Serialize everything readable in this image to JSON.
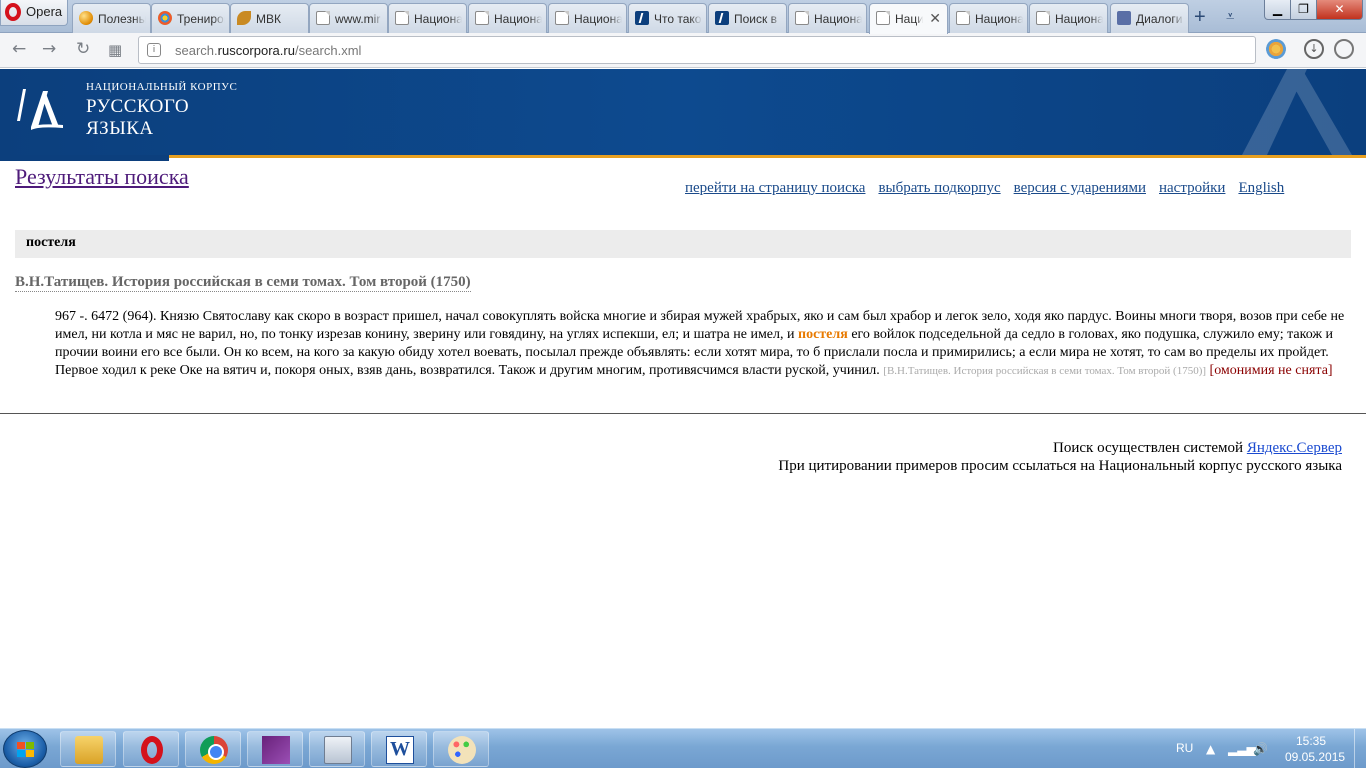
{
  "browser": {
    "menu_label": "Opera",
    "tabs": [
      {
        "title": "Полезные",
        "icon": "ball-icon"
      },
      {
        "title": "Тренировка",
        "icon": "flower-icon"
      },
      {
        "title": "МВК",
        "icon": "leaf-icon"
      },
      {
        "title": "www.mir",
        "icon": "page-icon"
      },
      {
        "title": "Национальный",
        "icon": "page-icon"
      },
      {
        "title": "Национальный",
        "icon": "page-icon"
      },
      {
        "title": "Национальный",
        "icon": "page-icon"
      },
      {
        "title": "Что такое",
        "icon": "nkrja-icon"
      },
      {
        "title": "Поиск в",
        "icon": "nkrja-icon"
      },
      {
        "title": "Национальный",
        "icon": "page-icon"
      },
      {
        "title": "Национальный",
        "icon": "page-icon",
        "active": true
      },
      {
        "title": "Национальный",
        "icon": "page-icon"
      },
      {
        "title": "Национальный",
        "icon": "page-icon"
      },
      {
        "title": "Диалоги",
        "icon": "dialog-icon"
      }
    ],
    "url_prefix": "search.",
    "url_host": "ruscorpora.ru",
    "url_path": "/search.xml",
    "site_icon": "i"
  },
  "site": {
    "header_line1": "НАЦИОНАЛЬНЫЙ КОРПУС",
    "header_line2": "РУССКОГО",
    "header_line3": "ЯЗЫКА",
    "brand_color": "#0c3f7d",
    "accent_color": "#e8a020"
  },
  "page": {
    "title": "Результаты поиска",
    "links": [
      "перейти на страницу поиска",
      "выбрать подкорпус",
      "версия с ударениями",
      "настройки",
      "English"
    ],
    "query": "постеля",
    "doc_title": "В.Н.Татищев. История российская в семи томах. Том второй (1750)",
    "snippet_before": "967 -. 6472 (964). Князю Святославу как скоро в возраст пришел, начал совокуплять войска многие и збирая мужей храбрых, яко и сам был храбор и легок зело, ходя яко пардус. Воины многи творя, возов при себе не имел, ни котла и мяс не варил, но, по тонку изрезав конину, зверину или говядину, на углях испекши, ел; и шатра не имел, и ",
    "snippet_highlight": "постеля",
    "snippet_after": " его войлок подседельной да седло в головах, яко подушка, служило ему; також и прочии воини его все были. Он ко всем, на кого за какую обиду хотел воевать, посылал прежде объявлять: если хотят мира, то б прислали посла и примирились; а если мира не хотят, то сам во пределы их пройдет. Первое ходил к реке Оке на вятич и, покоря оных, взяв дань, возвратился. Також и другим многим, противясчимся власти руской, учинил. ",
    "snippet_source": "[В.Н.Татищев. История российская в семи томах. Том второй (1750)]",
    "snippet_homonymy": "[омонимия не снята]",
    "highlight_color": "#e87a00",
    "footer_search_text": "Поиск осуществлен системой ",
    "footer_search_link": "Яндекс.Сервер",
    "footer_cite": "При цитировании примеров просим ссылаться на Национальный корпус русского языка"
  },
  "taskbar": {
    "apps": [
      "explorer-icon",
      "opera-icon",
      "chrome-icon",
      "visual-studio-icon",
      "calculator-icon",
      "word-icon",
      "paint-icon"
    ],
    "lang": "RU",
    "time": "15:35",
    "date": "09.05.2015"
  }
}
